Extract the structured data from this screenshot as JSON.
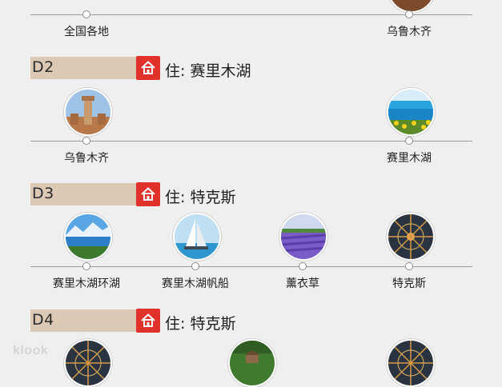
{
  "day1": {
    "stops": [
      {
        "label": "全国各地"
      },
      {
        "label": "乌鲁木齐"
      }
    ]
  },
  "day2": {
    "code": "D2",
    "stay": "住: 赛里木湖",
    "stops": [
      {
        "label": "乌鲁木齐",
        "photo": "tower-photo"
      },
      {
        "label": "赛里木湖",
        "photo": "lake-photo"
      }
    ]
  },
  "day3": {
    "code": "D3",
    "stay": "住: 特克斯",
    "stops": [
      {
        "label": "赛里木湖环湖",
        "photo": "lake-mountain-photo"
      },
      {
        "label": "赛里木湖帆船",
        "photo": "sailboat-photo"
      },
      {
        "label": "薰衣草",
        "photo": "lavender-photo"
      },
      {
        "label": "特克斯",
        "photo": "town-night-photo"
      }
    ]
  },
  "day4": {
    "code": "D4",
    "stay": "住: 特克斯"
  },
  "watermark": "klook",
  "colors": {
    "accent": "#e0322b",
    "day_band": "#dcc9b5",
    "background": "#efefef",
    "line": "#9a9a9a"
  },
  "icons": {
    "stay_icon": "home-icon"
  }
}
